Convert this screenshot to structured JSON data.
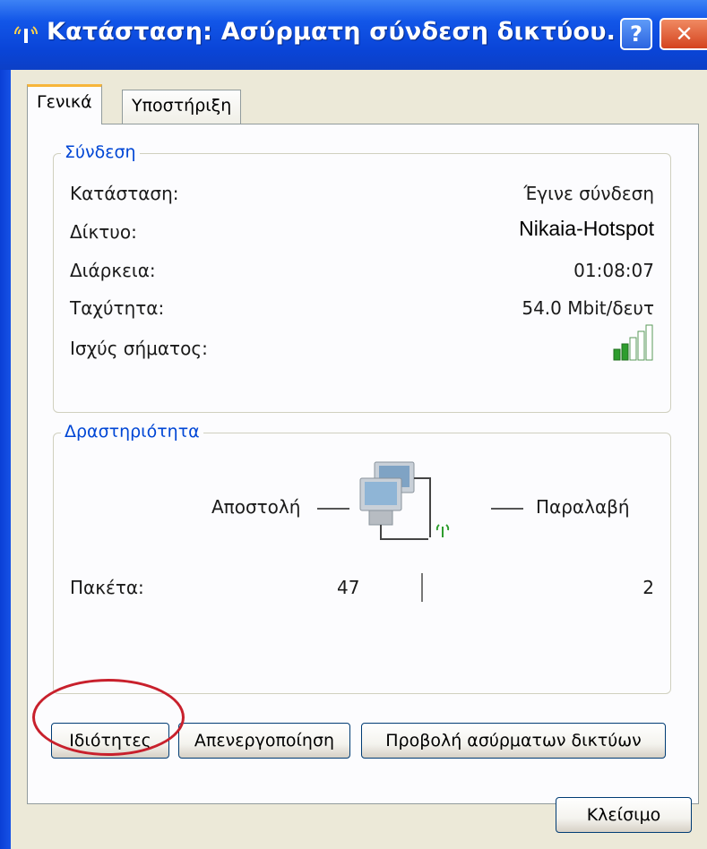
{
  "window": {
    "title": "Κατάσταση: Ασύρματη σύνδεση δικτύου.",
    "help_label": "?",
    "close_label": "✕"
  },
  "tabs": [
    {
      "label": "Γενικά",
      "active": true
    },
    {
      "label": "Υποστήριξη",
      "active": false
    }
  ],
  "connection": {
    "title": "Σύνδεση",
    "rows": [
      {
        "label": "Κατάσταση:",
        "value": "Έγινε σύνδεση"
      },
      {
        "label": "Δίκτυο:",
        "value": "Nikaia-Hotspot"
      },
      {
        "label": "Διάρκεια:",
        "value": "01:08:07"
      },
      {
        "label": "Ταχύτητα:",
        "value": "54.0 Mbit/δευτ"
      }
    ],
    "signal_label": "Ισχύς σήματος:",
    "signal_bars": 2,
    "signal_bars_total": 5
  },
  "activity": {
    "title": "Δραστηριότητα",
    "sent_label": "Αποστολή",
    "received_label": "Παραλαβή",
    "packets_label": "Πακέτα:",
    "packets_sent": "47",
    "packets_received": "2"
  },
  "buttons": {
    "properties": "Ιδιότητες",
    "disable": "Απενεργοποίηση",
    "view_networks": "Προβολή ασύρματων δικτύων",
    "close": "Κλείσιμο"
  },
  "colors": {
    "titlebar": "#0a45d8",
    "group_title": "#0046d5",
    "signal_active": "#2e9d2e",
    "highlight": "#c8202c"
  }
}
